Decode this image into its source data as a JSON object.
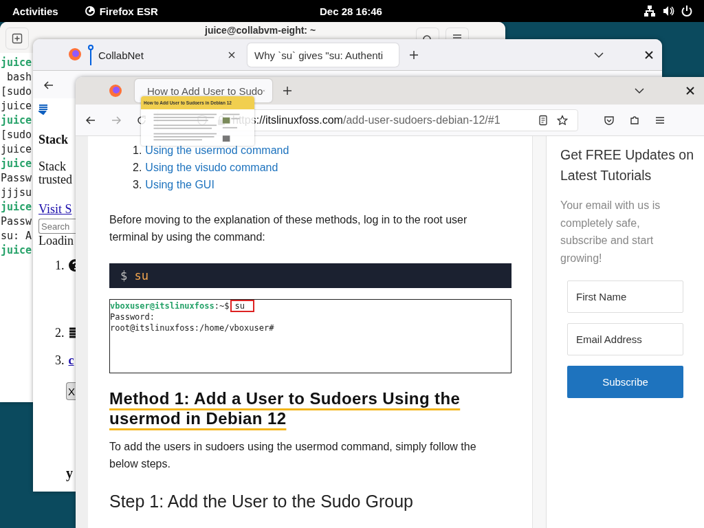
{
  "top_bar": {
    "activities": "Activities",
    "app": "Firefox ESR",
    "clock": "Dec 28  16:46"
  },
  "terminal": {
    "title": "juice@collabvm-eight: ~",
    "lines": [
      {
        "text": "juice",
        "kind": "prompt"
      },
      {
        "text": " bash",
        "kind": "output"
      },
      {
        "text": "[sudo",
        "kind": "output"
      },
      {
        "text": "juice",
        "kind": "output"
      },
      {
        "text": "juice",
        "kind": "prompt"
      },
      {
        "text": "[sudo",
        "kind": "output"
      },
      {
        "text": "juice",
        "kind": "output"
      },
      {
        "text": "juice",
        "kind": "prompt"
      },
      {
        "text": "Passw",
        "kind": "output"
      },
      {
        "text": "jjjsu",
        "kind": "output"
      },
      {
        "text": "juice",
        "kind": "prompt"
      },
      {
        "text": "Passw",
        "kind": "output"
      },
      {
        "text": "su: A",
        "kind": "output"
      },
      {
        "text": "juice",
        "kind": "prompt"
      }
    ]
  },
  "back_browser": {
    "tabs": [
      {
        "title": "CollabNet",
        "selected": false
      },
      {
        "title": "Why `su` gives \"su: Authenti",
        "selected": true
      }
    ],
    "page": {
      "heading": "Stack",
      "text_lines": [
        "Stack",
        "trusted"
      ],
      "link": "Visit S",
      "search_placeholder": "Search",
      "status": "Loadin",
      "list": [
        {
          "number": "1.",
          "kind": "help-icon"
        },
        {
          "number": "2.",
          "kind": "stack-icon"
        },
        {
          "number": "3.",
          "kind": "link",
          "text": "c"
        }
      ],
      "close_button": "X",
      "footer": "y"
    }
  },
  "front_browser": {
    "tabs": [
      {
        "title": "How to Add User to Sudo",
        "selected": true
      }
    ],
    "preview": {
      "title": "How to Add User to Sudoers in Debian 12"
    },
    "url": {
      "host": "https://itslinuxfoss.com",
      "path": "/add-user-sudoers-debian-12/#1"
    },
    "article": {
      "methods": [
        {
          "number": "1.",
          "text": "Using the usermod command"
        },
        {
          "number": "2.",
          "text": "Using the visudo command"
        },
        {
          "number": "3.",
          "text": "Using the GUI"
        }
      ],
      "intro": "Before moving to the explanation of these methods, log in to the root user terminal by using the command:",
      "code": {
        "prompt": "$",
        "command": "su"
      },
      "terminal_image": {
        "user": "vboxuser@itslinuxfoss",
        "path": ":~$",
        "command": "su",
        "lines": [
          "Password:",
          "root@itslinuxfoss:/home/vboxuser#"
        ]
      },
      "heading": "Method 1: Add a User to Sudoers Using the usermod in Debian 12",
      "steps_intro": "To add the users in sudoers using the usermod command, simply follow the below steps.",
      "step_heading": "Step 1: Add the User to the Sudo Group"
    },
    "sidebar": {
      "title": "Get FREE Updates on Latest Tutorials",
      "text": "Your email with us is completely safe, subscribe and start growing!",
      "fields": [
        {
          "placeholder": "First Name"
        },
        {
          "placeholder": "Email Address"
        }
      ],
      "button": "Subscribe"
    }
  }
}
